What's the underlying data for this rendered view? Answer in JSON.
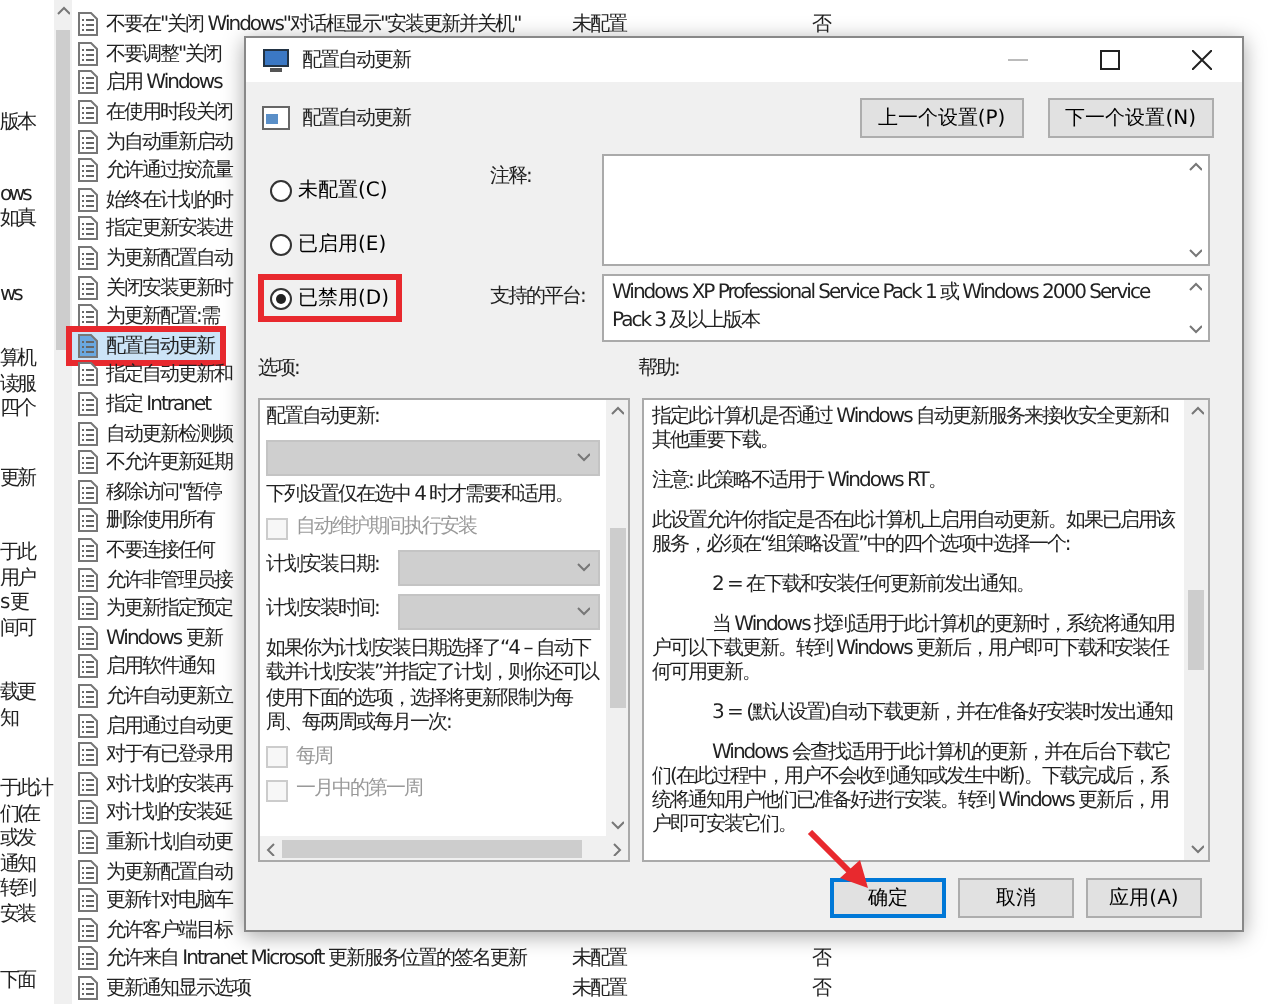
{
  "background": {
    "description_fragments": [
      [
        "版本"
      ],
      [
        "ows",
        "如真"
      ],
      [
        "ws"
      ],
      [
        "算机",
        "读服",
        "四个"
      ],
      [
        "更新"
      ],
      [
        "于此",
        "用户",
        "s 更",
        "间可"
      ],
      [
        "载更",
        "知"
      ],
      [
        "于此计",
        "们(在",
        "或发",
        "通知",
        "转到",
        "安装"
      ],
      [
        "下面"
      ]
    ],
    "policies": [
      {
        "name": "不要在\"关闭 Windows\"对话框显示\"安装更新并关机\"",
        "state": "未配置",
        "comment": "否",
        "selected": false,
        "annotated": false
      },
      {
        "name": "不要调整\"关闭",
        "selected": false,
        "annotated": false
      },
      {
        "name": "启用 Windows",
        "selected": false,
        "annotated": false
      },
      {
        "name": "在使用时段关闭",
        "selected": false,
        "annotated": false
      },
      {
        "name": "为自动重新启动",
        "selected": false,
        "annotated": false
      },
      {
        "name": "允许通过按流量",
        "selected": false,
        "annotated": false
      },
      {
        "name": "始终在计划的时",
        "selected": false,
        "annotated": false
      },
      {
        "name": "指定更新安装进",
        "selected": false,
        "annotated": false
      },
      {
        "name": "为更新配置自动",
        "selected": false,
        "annotated": false
      },
      {
        "name": "关闭安装更新时",
        "selected": false,
        "annotated": false
      },
      {
        "name": "为更新配置:需",
        "selected": false,
        "annotated": false
      },
      {
        "name": "配置自动更新",
        "selected": true,
        "annotated": true
      },
      {
        "name": "指定自动更新和",
        "selected": false,
        "annotated": false
      },
      {
        "name": "指定 Intranet",
        "selected": false,
        "annotated": false
      },
      {
        "name": "自动更新检测频",
        "selected": false,
        "annotated": false
      },
      {
        "name": "不允许更新延期",
        "selected": false,
        "annotated": false
      },
      {
        "name": "移除访问\"暂停",
        "selected": false,
        "annotated": false
      },
      {
        "name": "删除使用所有",
        "selected": false,
        "annotated": false
      },
      {
        "name": "不要连接任何",
        "selected": false,
        "annotated": false
      },
      {
        "name": "允许非管理员接",
        "selected": false,
        "annotated": false
      },
      {
        "name": "为更新指定预定",
        "selected": false,
        "annotated": false
      },
      {
        "name": "Windows 更新",
        "selected": false,
        "annotated": false
      },
      {
        "name": "启用软件通知",
        "selected": false,
        "annotated": false
      },
      {
        "name": "允许自动更新立",
        "selected": false,
        "annotated": false
      },
      {
        "name": "启用通过自动更",
        "selected": false,
        "annotated": false
      },
      {
        "name": "对于有已登录用",
        "selected": false,
        "annotated": false
      },
      {
        "name": "对计划的安装再",
        "selected": false,
        "annotated": false
      },
      {
        "name": "对计划的安装延",
        "selected": false,
        "annotated": false
      },
      {
        "name": "重新计划自动更",
        "selected": false,
        "annotated": false
      },
      {
        "name": "为更新配置自动",
        "selected": false,
        "annotated": false
      },
      {
        "name": "更新针对电脑车",
        "selected": false,
        "annotated": false
      },
      {
        "name": "允许客户端目标",
        "selected": false,
        "annotated": false
      },
      {
        "name": "允许来自 Intranet Microsoft 更新服务位置的签名更新",
        "state": "未配置",
        "comment": "否",
        "selected": false,
        "annotated": false
      },
      {
        "name": "更新通知显示选项",
        "state": "未配置",
        "comment": "否",
        "selected": false,
        "annotated": false
      }
    ]
  },
  "dialog": {
    "title": "配置自动更新",
    "heading": "配置自动更新",
    "nav_buttons": [
      "上一个设置(P)",
      "下一个设置(N)"
    ],
    "radios": [
      {
        "label": "未配置(C)",
        "selected": false,
        "annotated": false
      },
      {
        "label": "已启用(E)",
        "selected": false,
        "annotated": false
      },
      {
        "label": "已禁用(D)",
        "selected": true,
        "annotated": true
      }
    ],
    "comment": {
      "label": "注释:"
    },
    "platform": {
      "label": "支持的平台:",
      "value": "Windows XP Professional Service Pack 1 或 Windows 2000 Service Pack 3 及以上版本"
    },
    "options": {
      "label": "选项:",
      "items": [
        {
          "kind": "heading",
          "text": "配置自动更新:"
        },
        {
          "kind": "dropdown",
          "disabled": true
        },
        {
          "kind": "note",
          "text": "下列设置仅在选中 4 时才需要和适用。"
        },
        {
          "kind": "checkbox",
          "label": "自动维护期间执行安装",
          "checked": false,
          "disabled": true
        },
        {
          "kind": "field",
          "label": "计划安装日期:",
          "disabled": true
        },
        {
          "kind": "field",
          "label": "计划安装时间:",
          "disabled": true
        },
        {
          "kind": "note",
          "text": "如果你为计划安装日期选择了“4 – 自动下载并计划安装”并指定了计划，则你还可以使用下面的选项，选择将更新限制为每周、每两周或每月一次:"
        },
        {
          "kind": "checkbox",
          "label": "每周",
          "checked": false,
          "disabled": true
        },
        {
          "kind": "checkbox",
          "label": "一月中的第一周",
          "checked": false,
          "disabled": true
        }
      ]
    },
    "help": {
      "label": "帮助:",
      "paragraphs": [
        {
          "kind": "plain",
          "text": "指定此计算机是否通过 Windows 自动更新服务来接收安全更新和其他重要下载。"
        },
        {
          "kind": "plain",
          "text": "注意: 此策略不适用于 Windows RT。"
        },
        {
          "kind": "plain",
          "text": "此设置允许你指定是否在此计算机上启用自动更新。如果已启用该服务，必须在“组策略设置”中的四个选项中选择一个:"
        },
        {
          "kind": "item",
          "text": "2 = 在下载和安装任何更新前发出通知。"
        },
        {
          "kind": "indent",
          "text": "当 Windows 找到适用于此计算机的更新时，系统将通知用户可以下载更新。转到 Windows 更新后，用户即可下载和安装任何可用更新。"
        },
        {
          "kind": "item",
          "text": "3 = (默认设置)自动下载更新，并在准备好安装时发出通知"
        },
        {
          "kind": "indent",
          "text": "Windows 会查找适用于此计算机的更新，并在后台下载它们(在此过程中，用户不会收到通知或发生中断)。下载完成后，系统将通知用户他们已准备好进行安装。转到 Windows 更新后，用户即可安装它们。"
        }
      ]
    },
    "buttons": [
      {
        "label": "确定",
        "default": true,
        "annotated": true
      },
      {
        "label": "取消",
        "default": false,
        "annotated": false
      },
      {
        "label": "应用(A)",
        "default": false,
        "annotated": false
      }
    ]
  }
}
